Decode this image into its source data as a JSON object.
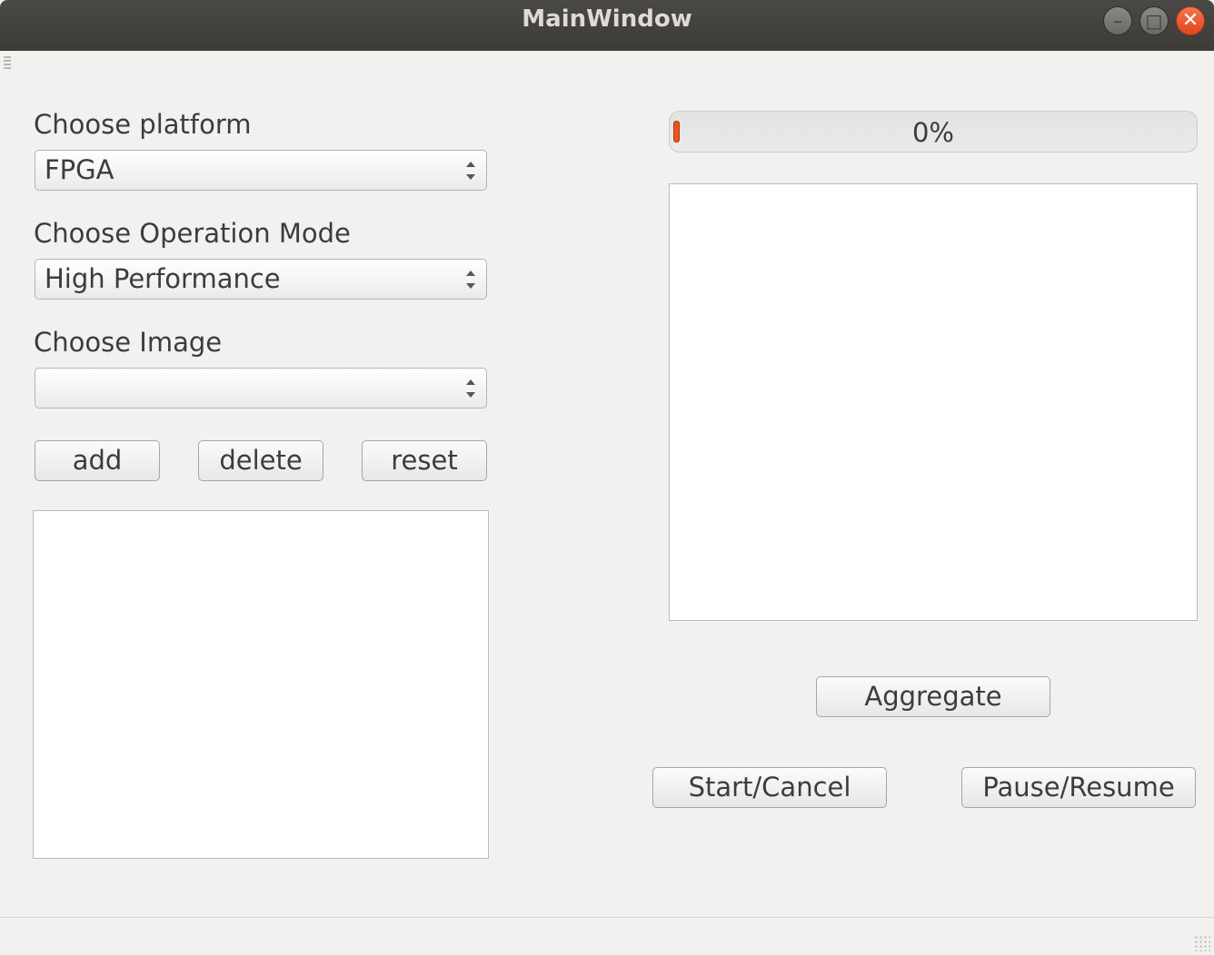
{
  "window": {
    "title": "MainWindow"
  },
  "left": {
    "platform": {
      "label": "Choose platform",
      "value": "FPGA"
    },
    "mode": {
      "label": "Choose Operation Mode",
      "value": "High Performance"
    },
    "image": {
      "label": "Choose Image",
      "value": ""
    },
    "buttons": {
      "add": "add",
      "delete": "delete",
      "reset": "reset"
    }
  },
  "right": {
    "progress": {
      "value": 0,
      "text": "0%"
    },
    "buttons": {
      "aggregate": "Aggregate",
      "start_cancel": "Start/Cancel",
      "pause_resume": "Pause/Resume"
    }
  },
  "colors": {
    "accent": "#e95420",
    "titlebar": "#3c3b37",
    "background": "#f2f1f0"
  },
  "icons": {
    "minimize": "minimize-icon",
    "maximize": "maximize-icon",
    "close": "close-icon"
  }
}
